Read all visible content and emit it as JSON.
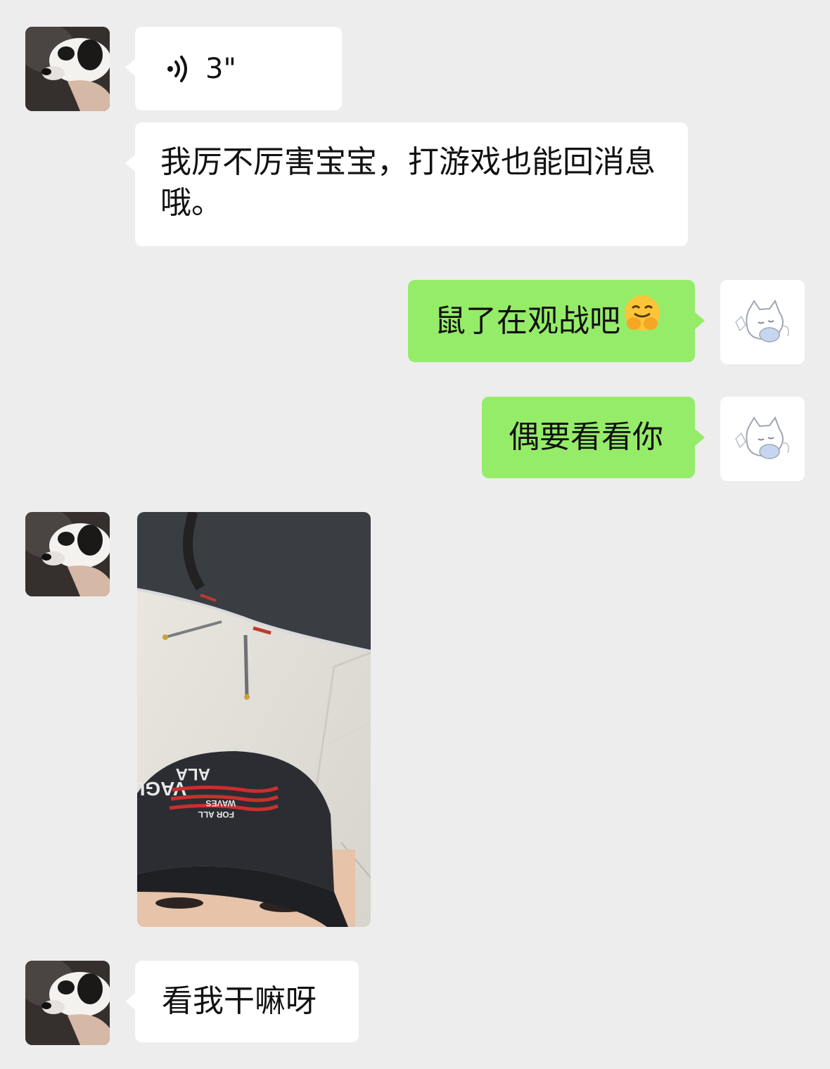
{
  "messages": [
    {
      "type": "voice",
      "side": "left",
      "duration": "3\"",
      "icon": "voice-wave-icon"
    },
    {
      "type": "text",
      "side": "left",
      "text": "我厉不厉害宝宝，打游戏也能回消息哦。"
    },
    {
      "type": "text",
      "side": "right",
      "text": "鼠了在观战吧",
      "emoji": "grinning-hands-emoji"
    },
    {
      "type": "text",
      "side": "right",
      "text": "偶要看看你"
    },
    {
      "type": "image",
      "side": "left",
      "cap_line1": "ALA",
      "cap_line2": "VAGUE",
      "cap_line3": "WAVES",
      "cap_line4": "FOR ALL"
    },
    {
      "type": "text",
      "side": "left",
      "text": "看我干嘛呀"
    }
  ],
  "colors": {
    "background": "#ededed",
    "bubble_self": "#95ec69",
    "bubble_other": "#ffffff"
  },
  "avatars": {
    "other": "dog-avatar",
    "self": "cat-sticker-avatar"
  }
}
